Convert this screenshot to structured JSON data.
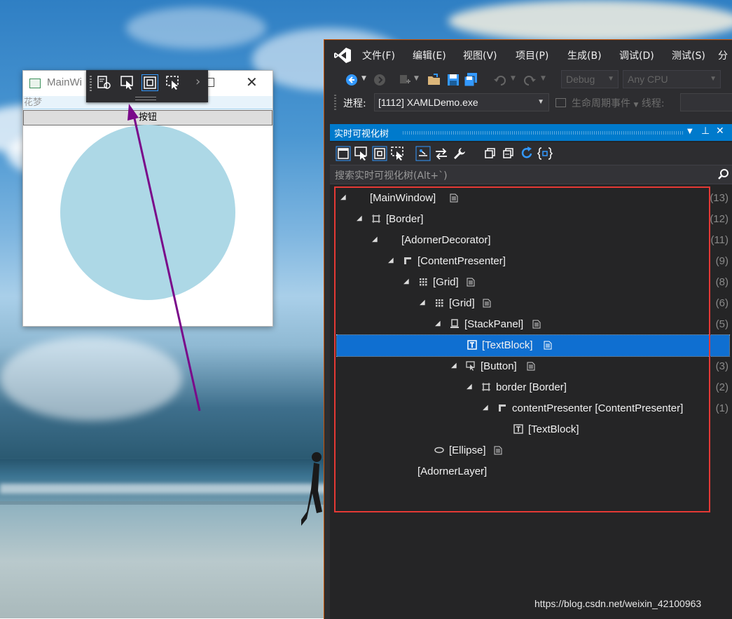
{
  "app_window": {
    "title": "MainWi",
    "textblock": "花梦",
    "button": "按钮"
  },
  "vs": {
    "menu": [
      "文件(F)",
      "编辑(E)",
      "视图(V)",
      "项目(P)",
      "生成(B)",
      "调试(D)",
      "测试(S)",
      "分"
    ],
    "config": "Debug",
    "platform": "Any CPU",
    "process_label": "进程:",
    "process_value": "[1112] XAMLDemo.exe",
    "lifecycle": "生命周期事件",
    "thread_label": "线程:"
  },
  "live_tree": {
    "title": "实时可视化树",
    "search_placeholder": "搜索实时可视化树(Alt+`)",
    "rows": [
      {
        "label": "[MainWindow]",
        "count": "(13)"
      },
      {
        "label": "[Border]",
        "count": "(12)"
      },
      {
        "label": "[AdornerDecorator]",
        "count": "(11)"
      },
      {
        "label": "[ContentPresenter]",
        "count": "(9)"
      },
      {
        "label": "[Grid]",
        "count": "(8)"
      },
      {
        "label": "[Grid]",
        "count": "(6)"
      },
      {
        "label": "[StackPanel]",
        "count": "(5)"
      },
      {
        "label": "[TextBlock]",
        "count": ""
      },
      {
        "label": "[Button]",
        "count": "(3)"
      },
      {
        "label": "border [Border]",
        "count": "(2)"
      },
      {
        "label": "contentPresenter [ContentPresenter]",
        "count": "(1)"
      },
      {
        "label": "[TextBlock]",
        "count": ""
      },
      {
        "label": "[Ellipse]",
        "count": ""
      },
      {
        "label": "[AdornerLayer]",
        "count": ""
      }
    ]
  },
  "watermark": "https://blog.csdn.net/weixin_42100963",
  "colors": {
    "accent": "#007acc",
    "selection": "#0f6fd1",
    "annotation_box": "#e53935",
    "arrow": "#7a0a8a",
    "ellipse": "#add8e6"
  }
}
